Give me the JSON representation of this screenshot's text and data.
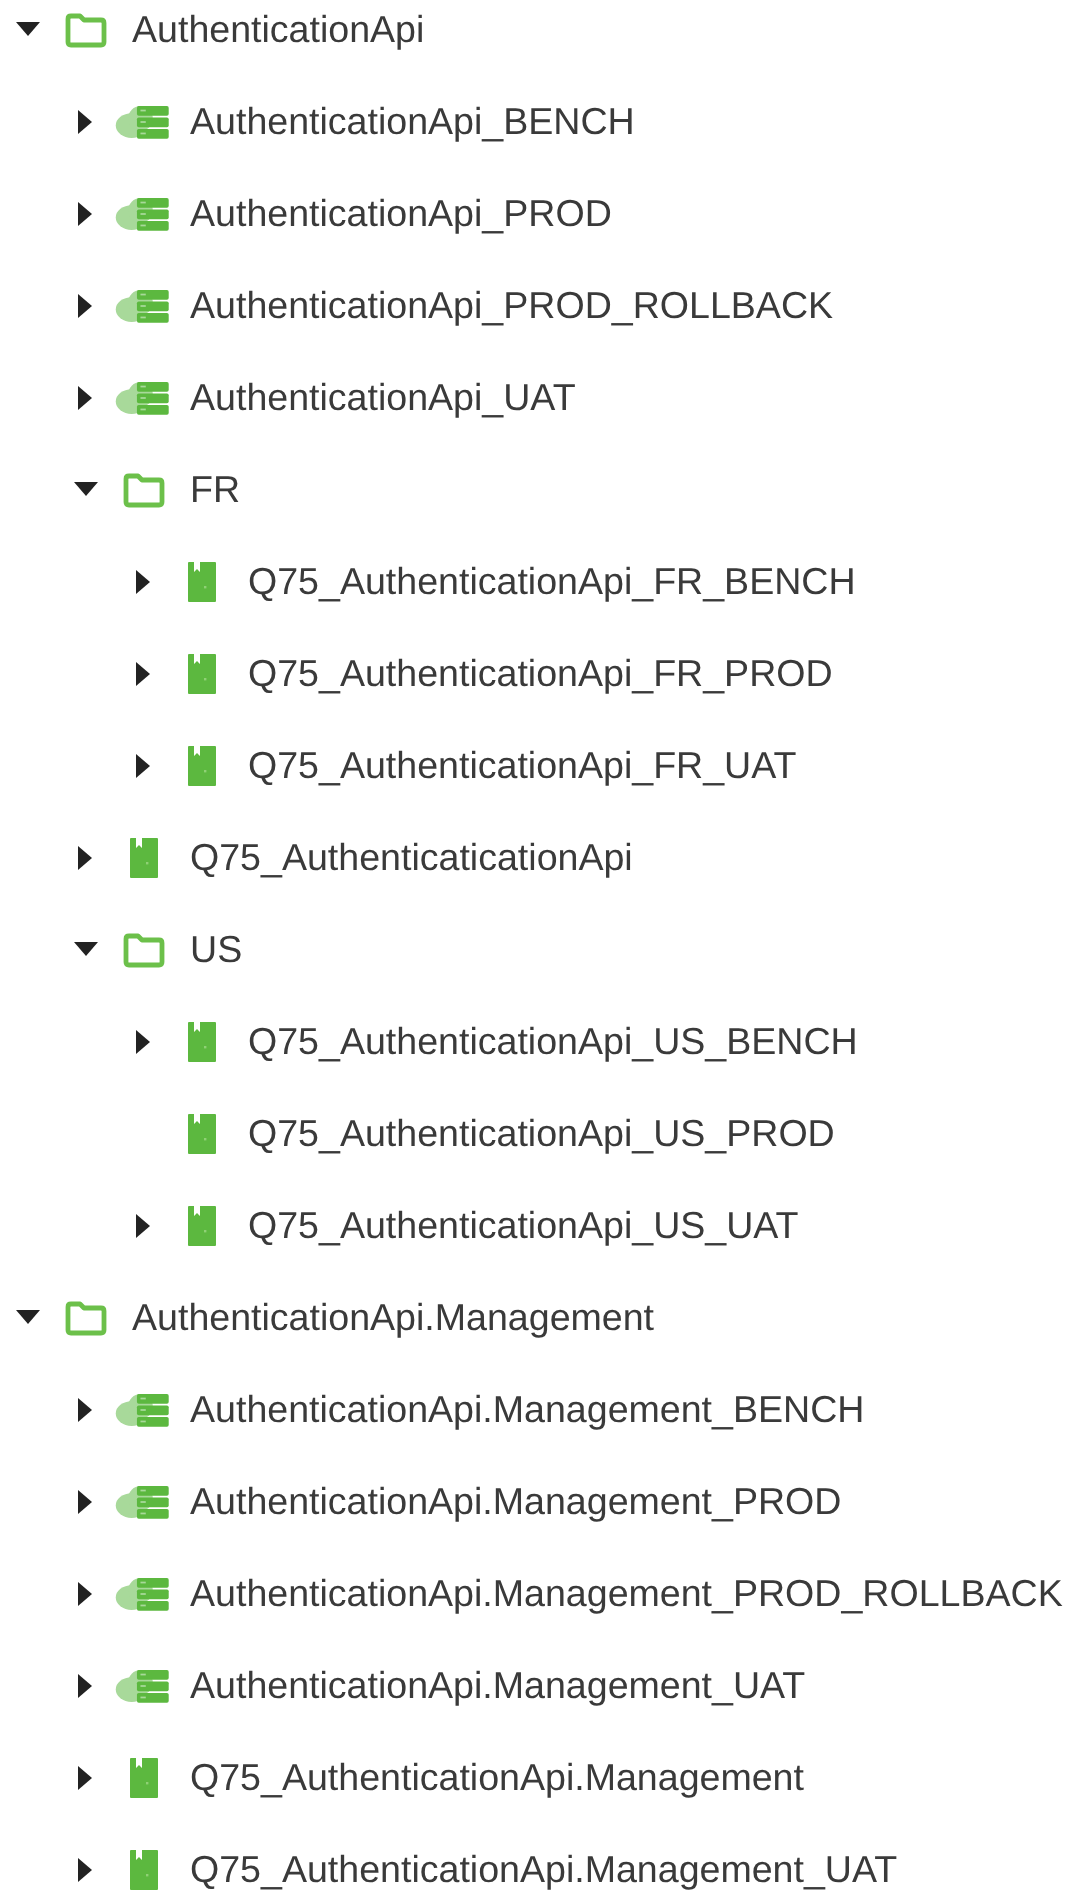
{
  "tree": [
    {
      "kind": "folder",
      "label": "AuthenticationApi",
      "expanded": true,
      "children": [
        {
          "kind": "server",
          "label": "AuthenticationApi_BENCH",
          "expanded": false
        },
        {
          "kind": "server",
          "label": "AuthenticationApi_PROD",
          "expanded": false
        },
        {
          "kind": "server",
          "label": "AuthenticationApi_PROD_ROLLBACK",
          "expanded": false
        },
        {
          "kind": "server",
          "label": "AuthenticationApi_UAT",
          "expanded": false
        },
        {
          "kind": "folder",
          "label": "FR",
          "expanded": true,
          "children": [
            {
              "kind": "book",
              "label": "Q75_AuthenticationApi_FR_BENCH",
              "expanded": false
            },
            {
              "kind": "book",
              "label": "Q75_AuthenticationApi_FR_PROD",
              "expanded": false
            },
            {
              "kind": "book",
              "label": "Q75_AuthenticationApi_FR_UAT",
              "expanded": false
            }
          ]
        },
        {
          "kind": "book",
          "label": "Q75_AuthenticaticationApi",
          "expanded": false
        },
        {
          "kind": "folder",
          "label": "US",
          "expanded": true,
          "children": [
            {
              "kind": "book",
              "label": "Q75_AuthenticationApi_US_BENCH",
              "expanded": false
            },
            {
              "kind": "book",
              "label": "Q75_AuthenticationApi_US_PROD"
            },
            {
              "kind": "book",
              "label": "Q75_AuthenticationApi_US_UAT",
              "expanded": false
            }
          ]
        }
      ]
    },
    {
      "kind": "folder",
      "label": "AuthenticationApi.Management",
      "expanded": true,
      "children": [
        {
          "kind": "server",
          "label": "AuthenticationApi.Management_BENCH",
          "expanded": false
        },
        {
          "kind": "server",
          "label": "AuthenticationApi.Management_PROD",
          "expanded": false
        },
        {
          "kind": "server",
          "label": "AuthenticationApi.Management_PROD_ROLLBACK",
          "expanded": false
        },
        {
          "kind": "server",
          "label": "AuthenticationApi.Management_UAT",
          "expanded": false
        },
        {
          "kind": "book",
          "label": "Q75_AuthenticationApi.Management",
          "expanded": false
        },
        {
          "kind": "book",
          "label": "Q75_AuthenticationApi.Management_UAT",
          "expanded": false
        }
      ]
    }
  ]
}
